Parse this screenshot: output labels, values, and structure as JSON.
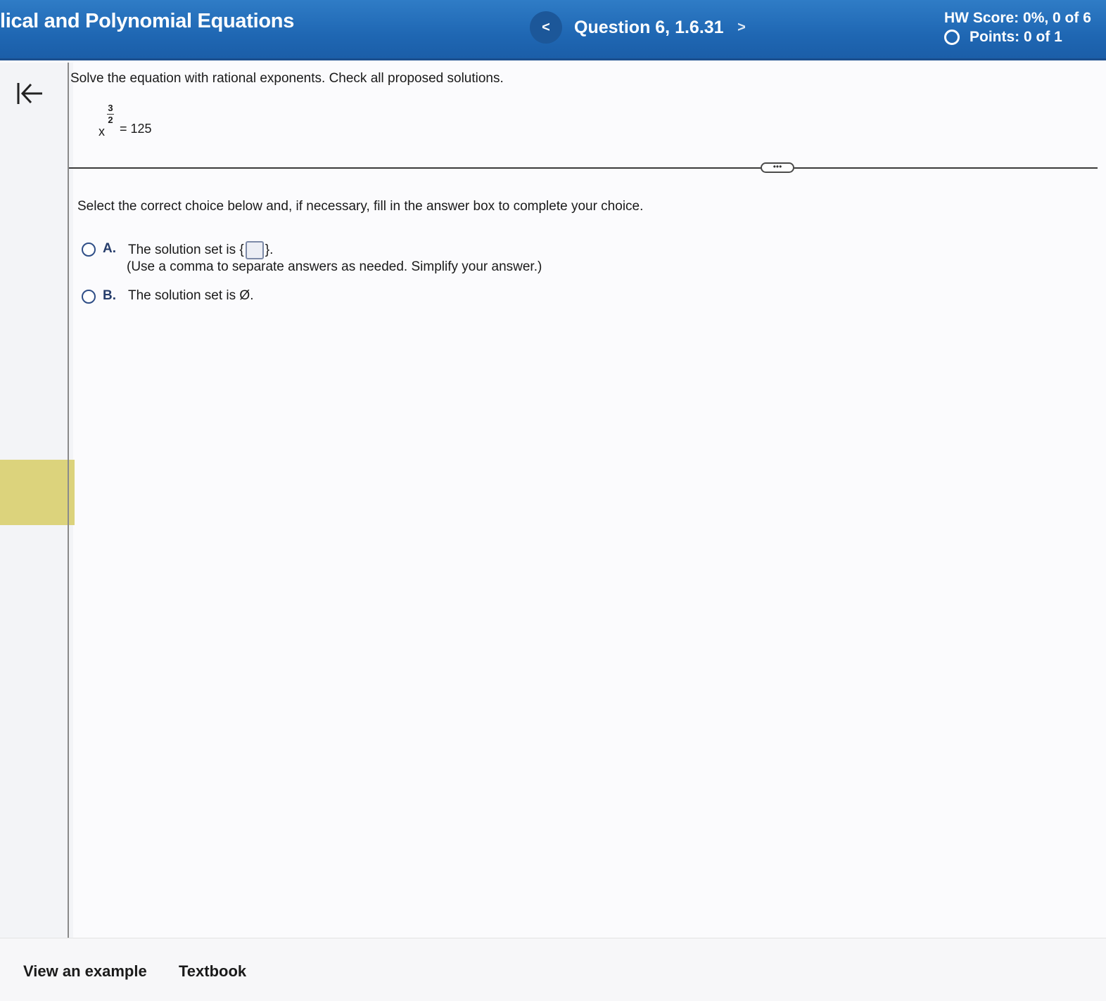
{
  "header": {
    "title": "lical and Polynomial Equations",
    "prev_icon": "<",
    "question_label": "Question 6, 1.6.31",
    "next_icon": ">",
    "hw_score": "HW Score: 0%, 0 of 6",
    "points": "Points: 0 of 1"
  },
  "problem": {
    "prompt": "Solve the equation with rational exponents. Check all proposed solutions.",
    "equation": {
      "base": "x",
      "exponent_numerator": "3",
      "exponent_denominator": "2",
      "rhs": "= 125"
    },
    "more_label": "•••"
  },
  "answer": {
    "instruction": "Select the correct choice below and, if necessary, fill in the answer box to complete your choice.",
    "choices": [
      {
        "letter": "A.",
        "text_before": "The solution set is {",
        "text_after": "}.",
        "hint": "(Use a comma to separate answers as needed. Simplify your answer.)"
      },
      {
        "letter": "B.",
        "text": "The solution set is Ø."
      }
    ]
  },
  "footer": {
    "view_example": "View an example",
    "textbook": "Textbook"
  },
  "icons": {
    "collapse": "collapse-left-icon",
    "prev": "chevron-left-icon",
    "next": "chevron-right-icon",
    "points_status": "circle-outline-icon"
  },
  "colors": {
    "header_blue": "#1f67b3",
    "nav_button": "#1c5799",
    "highlight_strip": "#dcd37c"
  }
}
